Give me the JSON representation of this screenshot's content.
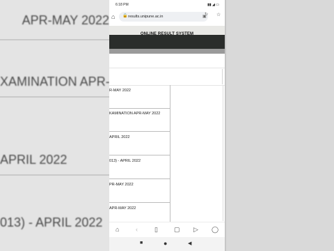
{
  "status_bar": {
    "time": "6:18 PM",
    "icons": "▮▮ ◢ ▭"
  },
  "browser": {
    "url": "results.unipune.ac.in",
    "home_icon": "⌂",
    "lock_icon": "🔒",
    "tabs_icon": "▣",
    "reload_icon": "↻",
    "star_icon": "☆"
  },
  "site": {
    "title": "ONLINE RESULT SYSTEM"
  },
  "exams": [
    {
      "name": "R-MAY 2022"
    },
    {
      "name": "KAMINATION APR-MAY 2022"
    },
    {
      "name": "APRIL 2022"
    },
    {
      "name": "013) - APRIL 2022"
    },
    {
      "name": "PR-MAY 2022"
    },
    {
      "name": "APR-MAY 2022"
    }
  ],
  "background": {
    "rows": [
      {
        "text": "APR-MAY 2022"
      },
      {
        "text": "XAMINATION APR-MAY 2022"
      },
      {
        "text": "APRIL 2022"
      },
      {
        "text": "013) - APRIL 2022"
      }
    ]
  },
  "browser_nav": {
    "home": "⌂",
    "back": "‹",
    "bookmarks": "▯",
    "tabs": "▢",
    "video": "▷",
    "profile": "◯"
  },
  "system_nav": {
    "recents": "■",
    "home": "●",
    "back": "◀"
  },
  "colors": {
    "header_dark": "#2a2d2b",
    "header_light": "#e9e9e6",
    "band_grey": "#9a9a9a"
  }
}
